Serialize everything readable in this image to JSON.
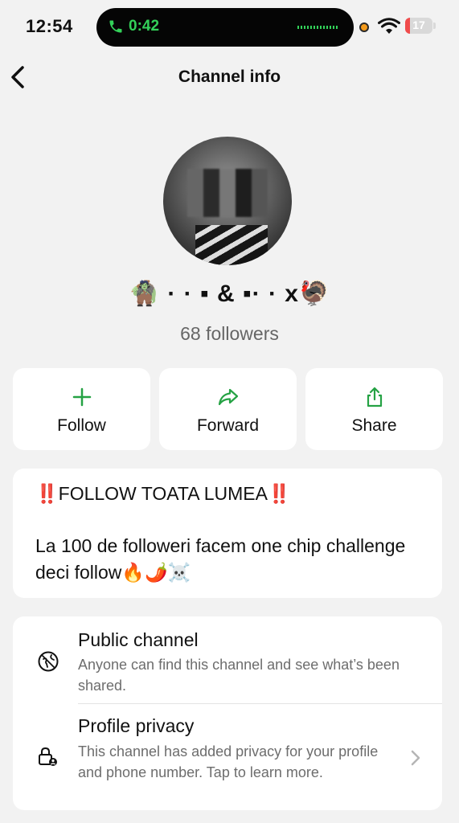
{
  "status_bar": {
    "time": "12:54",
    "call_duration": "0:42",
    "battery": "17",
    "battery_level": 0.17,
    "accent_call": "#33d159"
  },
  "nav": {
    "title": "Channel info"
  },
  "channel": {
    "name": "🧌 · · ▪ & ▪· · x🦃",
    "followers": "68 followers"
  },
  "actions": {
    "follow": "Follow",
    "forward": "Forward",
    "share": "Share",
    "accent": "#25a244"
  },
  "description": {
    "title_text": "FOLLOW TOATA LUMEA",
    "title_prefix": "‼️",
    "title_suffix": "‼️",
    "body": "La 100 de followeri facem one chip challenge deci follow🔥🌶️☠️"
  },
  "info": {
    "public_title": "Public channel",
    "public_sub": "Anyone can find this channel and see what’s been shared.",
    "privacy_title": "Profile privacy",
    "privacy_sub": "This channel has added privacy for your profile and phone number. Tap to learn more."
  }
}
